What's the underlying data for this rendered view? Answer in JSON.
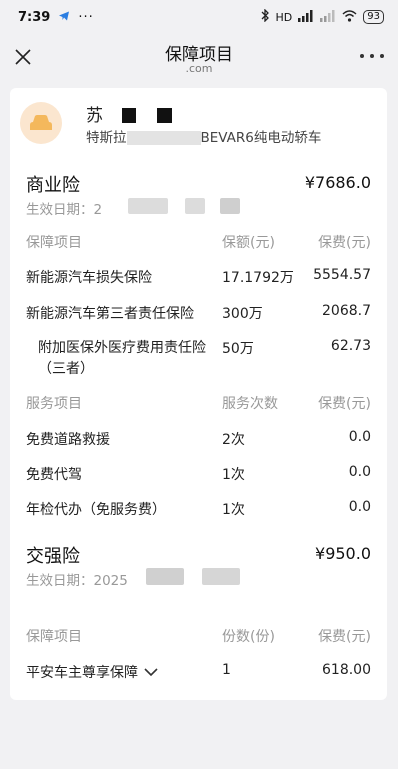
{
  "status_bar": {
    "time": "7:39",
    "dots": "···",
    "network_label": "HD",
    "battery": "93"
  },
  "nav": {
    "title": "保障项目",
    "domain": ".com"
  },
  "vehicle": {
    "owner_name_prefix": "苏",
    "model_prefix": "特斯拉",
    "model_suffix": "BEVAR6纯电动轿车"
  },
  "commercial": {
    "title": "商业险",
    "amount": "¥7686.0",
    "effective_label": "生效日期：2",
    "header": {
      "item": "保障项目",
      "coverage": "保额(元)",
      "premium": "保费(元)"
    },
    "items": [
      {
        "name": "新能源汽车损失保险",
        "coverage": "17.1792万",
        "premium": "5554.57"
      },
      {
        "name": "新能源汽车第三者责任保险",
        "coverage": "300万",
        "premium": "2068.7"
      },
      {
        "name": "附加医保外医疗费用责任险（三者）",
        "coverage": "50万",
        "premium": "62.73"
      }
    ],
    "service_header": {
      "item": "服务项目",
      "count": "服务次数",
      "premium": "保费(元)"
    },
    "services": [
      {
        "name": "免费道路救援",
        "count": "2次",
        "premium": "0.0"
      },
      {
        "name": "免费代驾",
        "count": "1次",
        "premium": "0.0"
      },
      {
        "name": "年检代办（免服务费）",
        "count": "1次",
        "premium": "0.0"
      }
    ]
  },
  "compulsory": {
    "title": "交强险",
    "amount": "¥950.0",
    "effective_label": "生效日期：2025",
    "header": {
      "item": "保障项目",
      "count": "份数(份)",
      "premium": "保费(元)"
    },
    "items": [
      {
        "name": "平安车主尊享保障",
        "count": "1",
        "premium": "618.00"
      }
    ]
  }
}
